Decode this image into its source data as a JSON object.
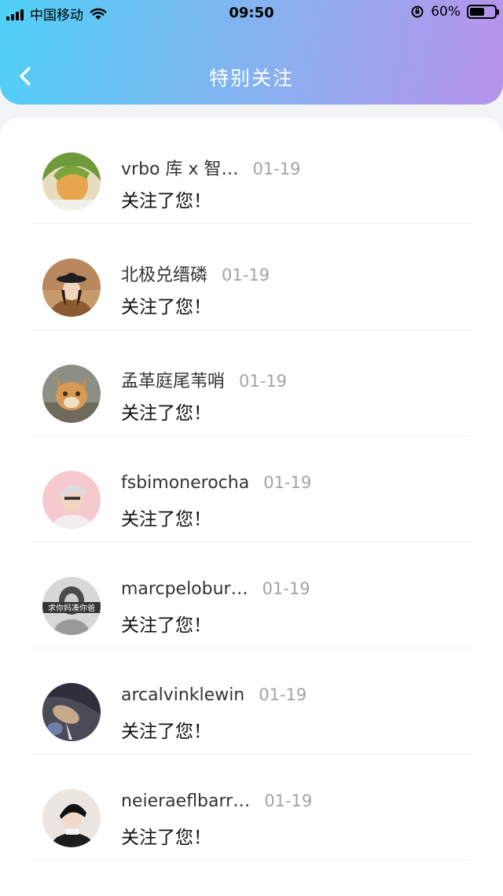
{
  "status_bar": {
    "carrier": "中国移动",
    "time": "09:50",
    "battery": "60%",
    "battery_level": 0.6
  },
  "header": {
    "title": "特别关注"
  },
  "notifications": [
    {
      "name": "vrbo 库 x 智…",
      "date": "01-19",
      "action": "关注了您！",
      "avatar": "anime-character-avatar"
    },
    {
      "name": "北极兑缙磷",
      "date": "01-19",
      "action": "关注了您！",
      "avatar": "woman-hat-avatar"
    },
    {
      "name": "孟革庭尾苇哨",
      "date": "01-19",
      "action": "关注了您！",
      "avatar": "cat-avatar"
    },
    {
      "name": "fsbimonerocha",
      "date": "01-19",
      "action": "关注了您！",
      "avatar": "person-pink-avatar"
    },
    {
      "name": "marcpelobur…",
      "date": "01-19",
      "action": "关注了您！",
      "avatar": "woman-bw-avatar",
      "avatar_text": "求你妈凑你爸"
    },
    {
      "name": "arcalvinklewin",
      "date": "01-19",
      "action": "关注了您！",
      "avatar": "dark-portrait-avatar"
    },
    {
      "name": "neieraeflbarr…",
      "date": "01-19",
      "action": "关注了您！",
      "avatar": "person-beanie-avatar"
    }
  ]
}
